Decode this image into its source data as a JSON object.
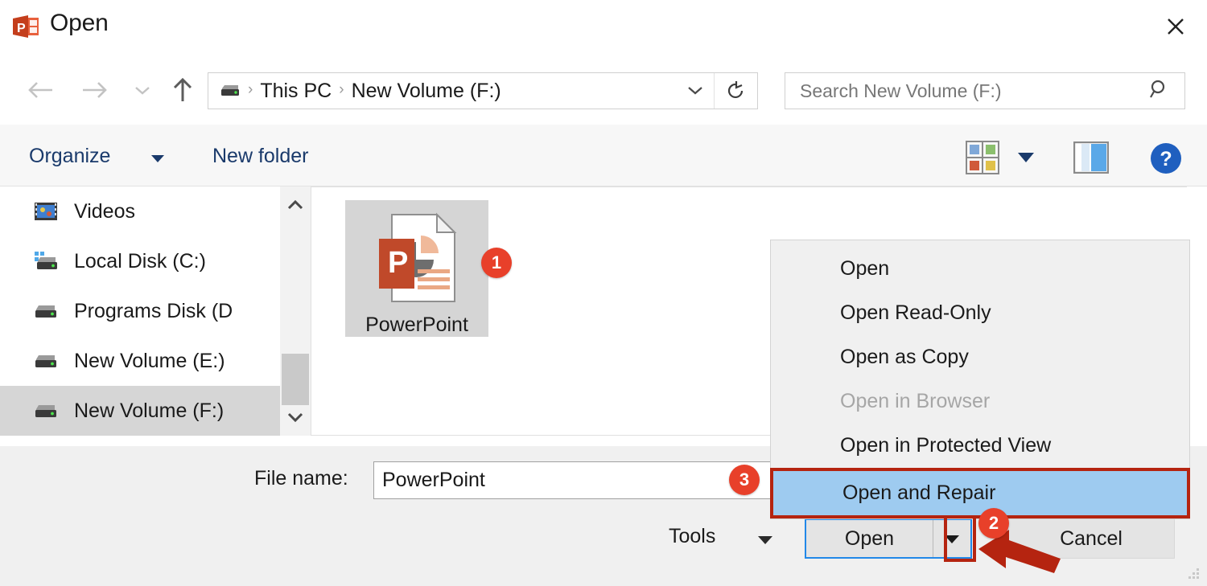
{
  "window": {
    "title": "Open",
    "app_icon": "powerpoint-icon",
    "close_label": "Close"
  },
  "nav": {
    "back": "Back",
    "forward": "Forward",
    "recent": "Recent locations",
    "up": "Up one level"
  },
  "address": {
    "drive_icon": "drive-icon",
    "crumbs": [
      "This PC",
      "New Volume (F:)"
    ],
    "separator": "›",
    "dropdown": "⌄",
    "refresh": "Refresh"
  },
  "search": {
    "placeholder": "Search New Volume (F:)",
    "value": "",
    "icon": "search-icon"
  },
  "commandbar": {
    "organize": "Organize",
    "new_folder": "New folder",
    "view_icon": "view-layout-icon",
    "view_caret": "chevron-down-icon",
    "preview_pane_icon": "preview-pane-icon",
    "help_icon": "help-icon"
  },
  "sidebar": {
    "items": [
      {
        "label": "Videos",
        "icon": "videos-icon",
        "selected": false
      },
      {
        "label": "Local Disk (C:)",
        "icon": "system-drive-icon",
        "selected": false
      },
      {
        "label": "Programs Disk (D",
        "icon": "drive-icon",
        "selected": false
      },
      {
        "label": "New Volume (E:)",
        "icon": "drive-icon",
        "selected": false
      },
      {
        "label": "New Volume (F:)",
        "icon": "drive-icon",
        "selected": true
      }
    ],
    "scroll_up": "Scroll up",
    "scroll_down": "Scroll down"
  },
  "files": [
    {
      "name": "PowerPoint",
      "icon": "powerpoint-file-icon",
      "selected": true
    }
  ],
  "filename": {
    "label": "File name:",
    "value": "PowerPoint"
  },
  "buttons": {
    "tools": "Tools",
    "tools_caret": "chevron-down-icon",
    "open": "Open",
    "open_caret": "chevron-down-icon",
    "cancel": "Cancel"
  },
  "context_menu": {
    "items": [
      {
        "label": "Open",
        "state": "normal"
      },
      {
        "label": "Open Read-Only",
        "state": "normal"
      },
      {
        "label": "Open as Copy",
        "state": "normal"
      },
      {
        "label": "Open in Browser",
        "state": "disabled"
      },
      {
        "label": "Open in Protected View",
        "state": "normal"
      },
      {
        "label": "Open and Repair",
        "state": "highlighted"
      }
    ]
  },
  "annotations": {
    "markers": [
      "1",
      "2",
      "3"
    ],
    "accent_red": "#b52410",
    "marker_color": "#e8402a",
    "highlight_blue": "#9ecbf0",
    "focus_blue": "#2288e8"
  }
}
